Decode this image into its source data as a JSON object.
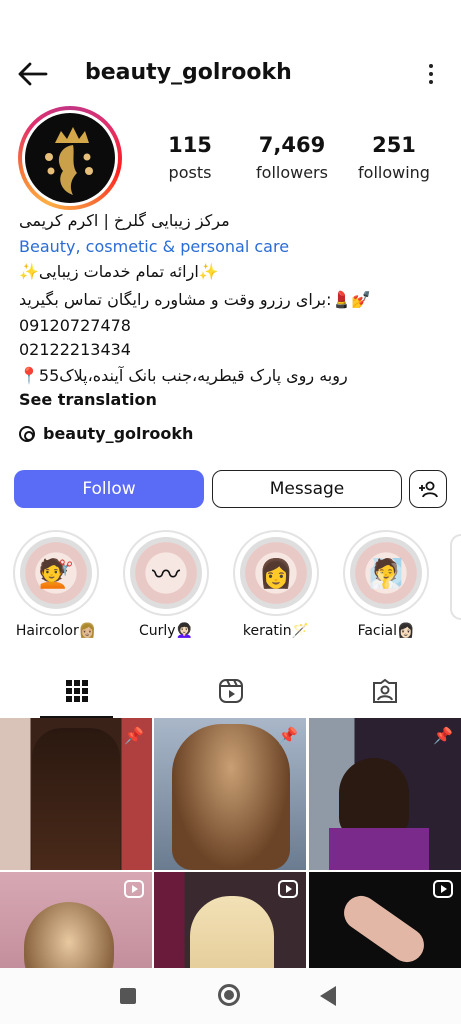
{
  "header": {
    "username": "beauty_golrookh"
  },
  "stats": [
    {
      "value": "115",
      "label": "posts"
    },
    {
      "value": "7,469",
      "label": "followers"
    },
    {
      "value": "251",
      "label": "following"
    }
  ],
  "bio": {
    "name": "مرکز زیبایی گلرخ | اکرم کریمی",
    "category": "Beauty, cosmetic & personal care",
    "line1": "✨ارائه تمام خدمات زیبایی✨",
    "line2": "💅💄:برای رزرو وقت و مشاوره رایگان تماس بگیرید",
    "phone1": "09120727478",
    "phone2": "02122213434",
    "address": "روبه روی پارک قیطریه،جنب بانک آینده،پلاک55📍",
    "see_translation": "See translation"
  },
  "threads": {
    "handle": "beauty_golrookh"
  },
  "buttons": {
    "follow": "Follow",
    "message": "Message"
  },
  "highlights": [
    {
      "label": "Haircolor👩🏼",
      "icon": "💇"
    },
    {
      "label": "Curly👩🏻‍🦱",
      "icon": "〰"
    },
    {
      "label": "keratin🪄",
      "icon": "👩"
    },
    {
      "label": "Facial👩🏻",
      "icon": "🧖"
    }
  ],
  "colors": {
    "follow": "#5a6cf5",
    "category": "#2a6cd6"
  }
}
